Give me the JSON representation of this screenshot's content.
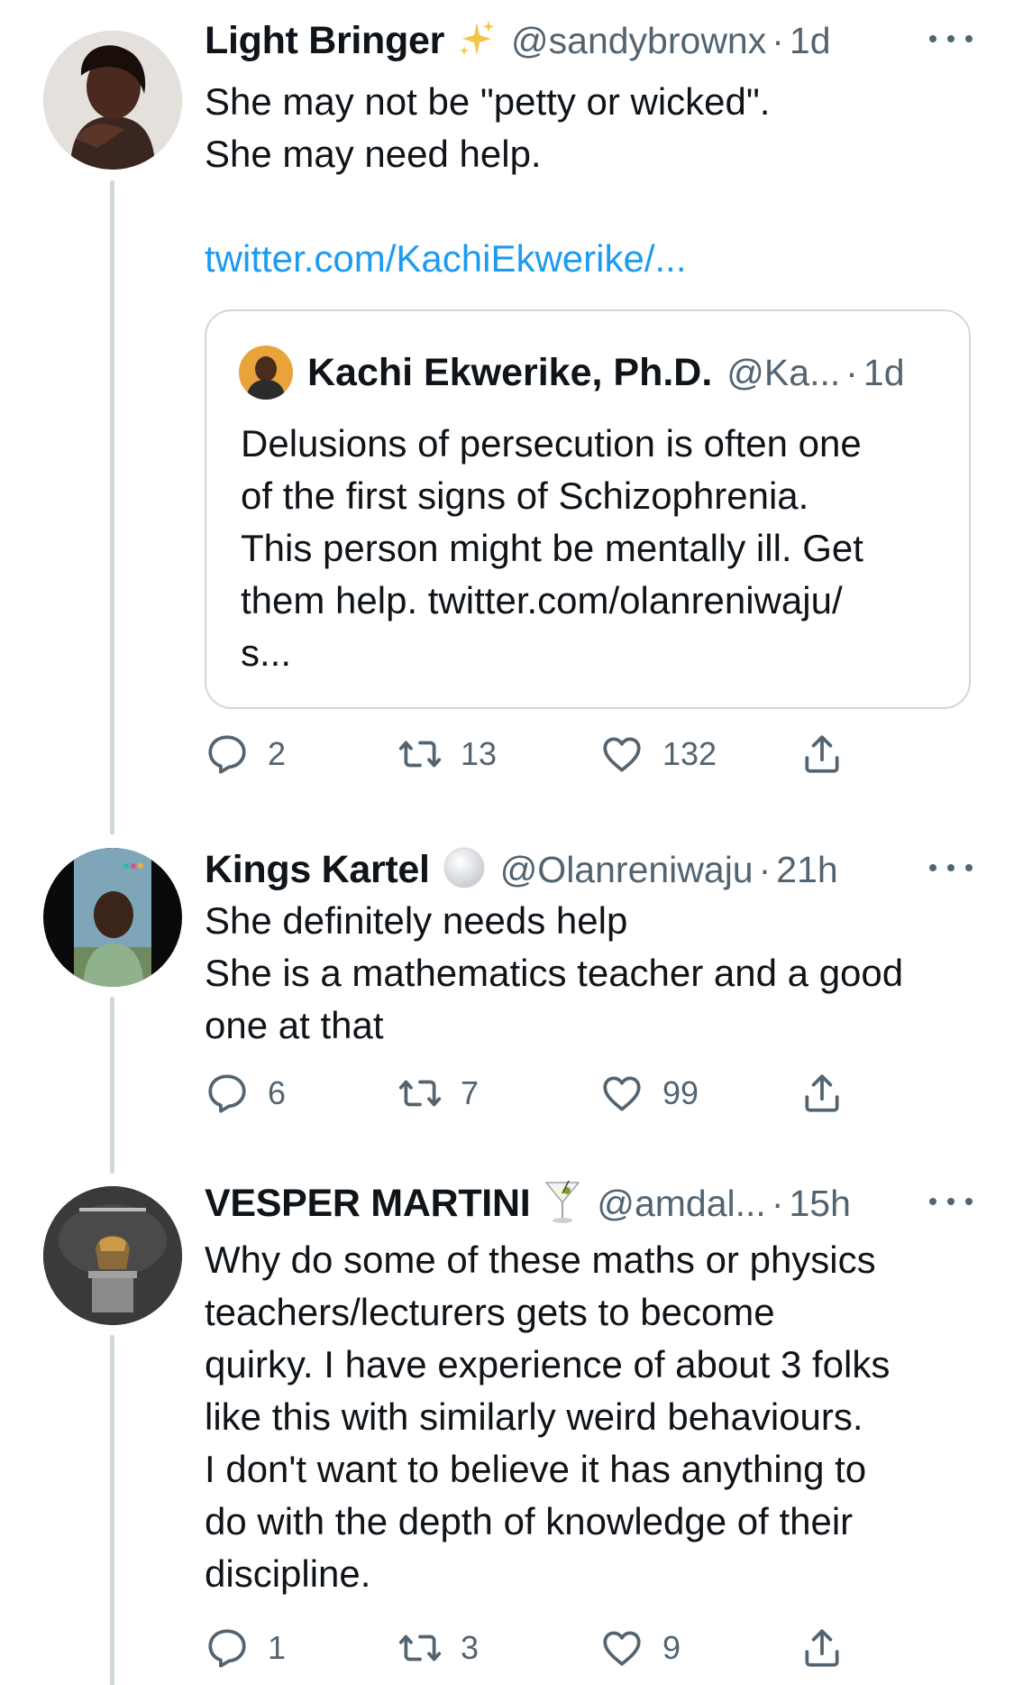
{
  "tweets": [
    {
      "author": {
        "name": "Light Bringer",
        "emoji": "sparkles-emoji",
        "handle": "@sandybrownx",
        "time": "1d"
      },
      "text_lines": [
        "She may not be \"petty or wicked\".",
        "She may need help."
      ],
      "link": "twitter.com/KachiEkwerike/...",
      "quote": {
        "author": {
          "name": "Kachi Ekwerike, Ph.D.",
          "handle": "@Ka...",
          "time": "1d"
        },
        "text_lines": [
          "Delusions of persecution is often one",
          "of the first signs of Schizophrenia.",
          "This person might be mentally ill. Get",
          "them help. twitter.com/olanreniwaju/",
          "s..."
        ]
      },
      "stats": {
        "replies": "2",
        "retweets": "13",
        "likes": "132"
      }
    },
    {
      "author": {
        "name": "Kings Kartel",
        "emoji": "white-circle-emoji",
        "handle": "@Olanreniwaju",
        "time": "21h"
      },
      "text_lines": [
        "She definitely needs help",
        "She is a mathematics teacher and a good",
        "one at that"
      ],
      "stats": {
        "replies": "6",
        "retweets": "7",
        "likes": "99"
      }
    },
    {
      "author": {
        "name": "VESPER MARTINI",
        "emoji": "cocktail-glass-emoji",
        "handle": "@amdal...",
        "time": "15h"
      },
      "text_lines": [
        "Why do some of these maths or physics",
        "teachers/lecturers gets to become",
        "quirky. I have experience of about 3 folks",
        "like this with similarly weird behaviours.",
        "I don't want to believe it has anything to",
        "do with the depth of knowledge of their",
        "discipline."
      ],
      "stats": {
        "replies": "1",
        "retweets": "3",
        "likes": "9"
      }
    }
  ],
  "separator": "·",
  "colors": {
    "text": "#0f1419",
    "secondary": "#536471",
    "link": "#1d9bf0",
    "thread_line": "#cfd9de"
  }
}
